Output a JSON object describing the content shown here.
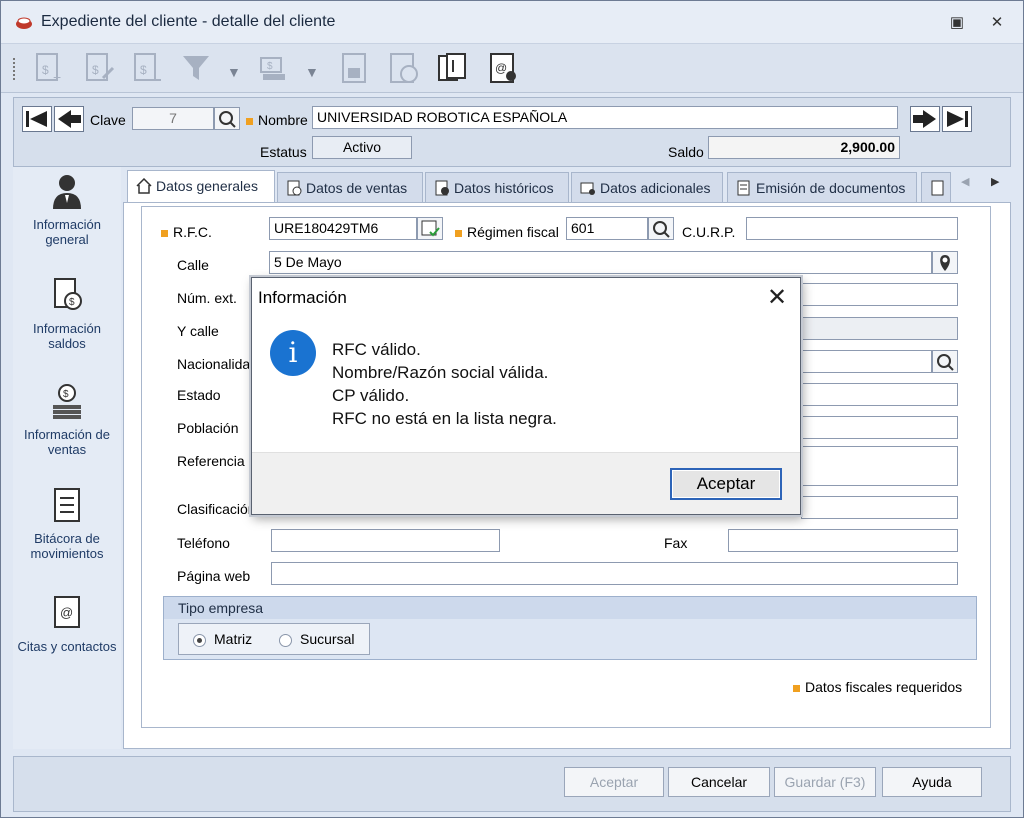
{
  "window": {
    "title": "Expediente del cliente - detalle del cliente"
  },
  "header": {
    "clave_label": "Clave",
    "clave_value": "7",
    "nombre_label": "Nombre",
    "nombre_value": "UNIVERSIDAD ROBOTICA ESPAÑOLA",
    "estatus_label": "Estatus",
    "estatus_value": "Activo",
    "saldo_label": "Saldo",
    "saldo_value": "2,900.00"
  },
  "sidebar": {
    "items": [
      {
        "label": "Información general",
        "icon": "person-icon"
      },
      {
        "label": "Información saldos",
        "icon": "balance-doc-icon"
      },
      {
        "label": "Información de ventas",
        "icon": "coins-icon"
      },
      {
        "label": "Bitácora de movimientos",
        "icon": "log-icon"
      },
      {
        "label": "Citas y contactos",
        "icon": "contacts-icon"
      }
    ]
  },
  "tabs": [
    {
      "label": "Datos generales"
    },
    {
      "label": "Datos de ventas"
    },
    {
      "label": "Datos históricos"
    },
    {
      "label": "Datos adicionales"
    },
    {
      "label": "Emisión de documentos"
    }
  ],
  "form": {
    "rfc_label": "R.F.C.",
    "rfc_value": "URE180429TM6",
    "regimen_label": "Régimen fiscal",
    "regimen_value": "601",
    "curp_label": "C.U.R.P.",
    "curp_value": "",
    "calle_label": "Calle",
    "calle_value": "5 De Mayo",
    "numext_label": "Núm. ext.",
    "ycalle_label": "Y calle",
    "nacionalidad_label": "Nacionalidad",
    "estado_label": "Estado",
    "poblacion_label": "Población",
    "referencia_label": "Referencia",
    "clasificacion_label": "Clasificación",
    "telefono_label": "Teléfono",
    "fax_label": "Fax",
    "pagina_label": "Página web",
    "tipo_empresa_label": "Tipo empresa",
    "matriz_label": "Matriz",
    "sucursal_label": "Sucursal",
    "required_note": "Datos fiscales requeridos"
  },
  "footer": {
    "aceptar": "Aceptar",
    "cancelar": "Cancelar",
    "guardar": "Guardar (F3)",
    "ayuda": "Ayuda"
  },
  "dialog": {
    "title": "Información",
    "lines": [
      "RFC válido.",
      "Nombre/Razón social válida.",
      "CP válido.",
      "RFC no está en la lista negra."
    ],
    "ok": "Aceptar"
  },
  "colors": {
    "accent": "#2d64b8",
    "required": "#f0a020",
    "info": "#1a73d1"
  }
}
